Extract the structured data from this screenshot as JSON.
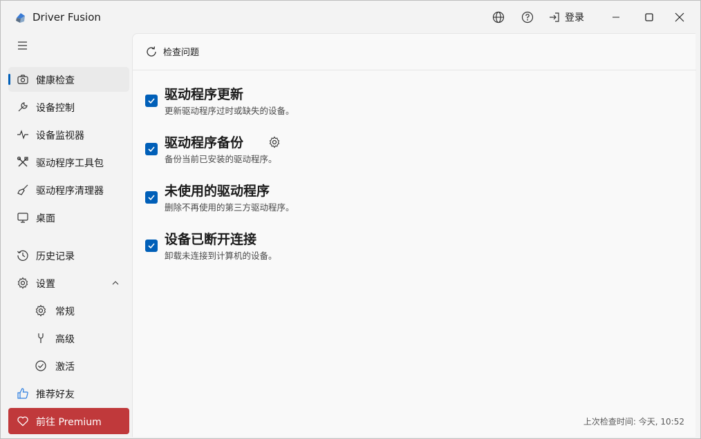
{
  "app": {
    "title": "Driver Fusion"
  },
  "titlebar": {
    "login_label": "登录"
  },
  "sidebar": {
    "items": [
      {
        "label": "健康检查",
        "icon": "camera-icon"
      },
      {
        "label": "设备控制",
        "icon": "wrench-icon"
      },
      {
        "label": "设备监视器",
        "icon": "pulse-icon"
      },
      {
        "label": "驱动程序工具包",
        "icon": "tools-icon"
      },
      {
        "label": "驱动程序清理器",
        "icon": "broom-icon"
      },
      {
        "label": "桌面",
        "icon": "monitor-icon"
      },
      {
        "label": "历史记录",
        "icon": "history-icon"
      },
      {
        "label": "设置",
        "icon": "gear-icon"
      },
      {
        "label": "常规",
        "icon": "gear-icon"
      },
      {
        "label": "高级",
        "icon": "advanced-icon"
      },
      {
        "label": "激活",
        "icon": "check-circle-icon"
      },
      {
        "label": "推荐好友",
        "icon": "thumbs-up-icon"
      }
    ],
    "premium_label": "前往 Premium"
  },
  "toolbar": {
    "check_label": "检查问题"
  },
  "tasks": [
    {
      "title": "驱动程序更新",
      "desc": "更新驱动程序过时或缺失的设备。",
      "checked": true
    },
    {
      "title": "驱动程序备份",
      "desc": "备份当前已安装的驱动程序。",
      "checked": true
    },
    {
      "title": "未使用的驱动程序",
      "desc": "删除不再使用的第三方驱动程序。",
      "checked": true
    },
    {
      "title": "设备已断开连接",
      "desc": "卸载未连接到计算机的设备。",
      "checked": true
    }
  ],
  "status": {
    "last_check": "上次检查时间: 今天, 10:52"
  },
  "colors": {
    "accent": "#005fb8",
    "premium": "#c0393b"
  }
}
